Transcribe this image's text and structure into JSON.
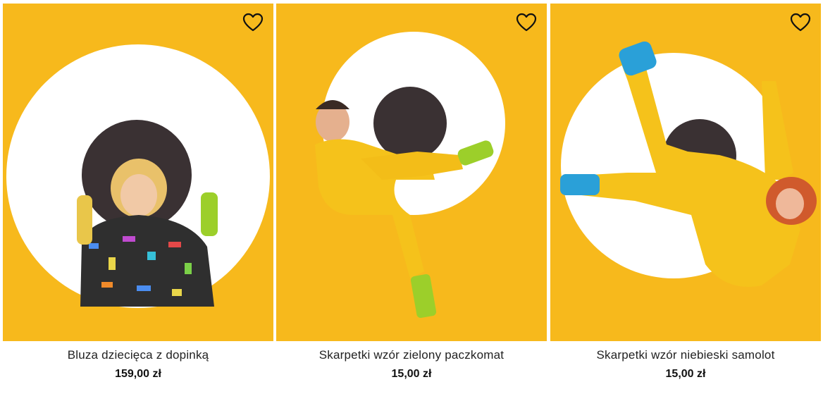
{
  "products": [
    {
      "name": "Bluza dziecięca z dopinką",
      "price": "159,00 zł",
      "image_alt": "photo",
      "favorite_icon": "heart-outline-icon"
    },
    {
      "name": "Skarpetki wzór zielony paczkomat",
      "price": "15,00 zł",
      "image_alt": "photo",
      "favorite_icon": "heart-outline-icon"
    },
    {
      "name": "Skarpetki wzór niebieski samolot",
      "price": "15,00 zł",
      "image_alt": "photo",
      "favorite_icon": "heart-outline-icon"
    }
  ],
  "colors": {
    "background_yellow": "#f7b91c",
    "circle_white": "#ffffff",
    "circle_dark": "#3a3133",
    "outfit_yellow": "#f5c21b",
    "sock_green": "#9ccf2a",
    "sock_blue": "#2aa0d8"
  }
}
